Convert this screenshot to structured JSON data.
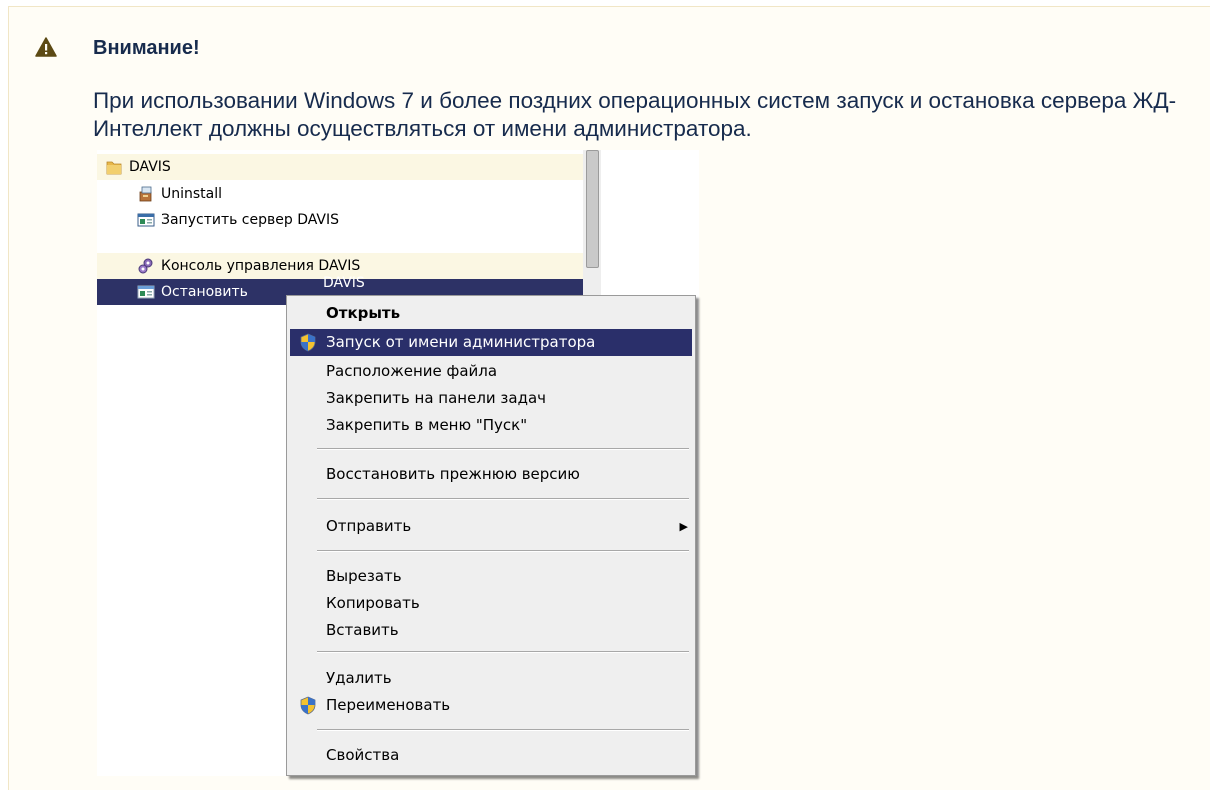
{
  "notice": {
    "title": "Внимание!",
    "text": "При использовании Windows 7 и более поздних операционных систем запуск и остановка сервера ЖД-Интеллект должны осуществляться от имени администратора."
  },
  "tree": {
    "folder": "DAVIS",
    "items": [
      {
        "label": "Uninstall",
        "icon": "installer-icon"
      },
      {
        "label": "Запустить сервер DAVIS",
        "icon": "app-window-icon"
      },
      {
        "label": "Консоль управления DAVIS",
        "icon": "gears-icon"
      },
      {
        "label": "Остановить",
        "icon": "app-window-icon"
      }
    ],
    "partial_after_selected": "DAVIS"
  },
  "context_menu": {
    "items": [
      {
        "label": "Открыть"
      },
      {
        "label": "Запуск от имени администратора"
      },
      {
        "label": "Расположение файла"
      },
      {
        "label": "Закрепить на панели задач"
      },
      {
        "label": "Закрепить в меню \"Пуск\""
      },
      {
        "label": "Восстановить прежнюю версию"
      },
      {
        "label": "Отправить"
      },
      {
        "label": "Вырезать"
      },
      {
        "label": "Копировать"
      },
      {
        "label": "Вставить"
      },
      {
        "label": "Удалить"
      },
      {
        "label": "Переименовать"
      },
      {
        "label": "Свойства"
      }
    ]
  },
  "colors": {
    "selection": "#2d3266",
    "hover": "#fbf7e3",
    "warning_icon": "#5c4a14"
  }
}
